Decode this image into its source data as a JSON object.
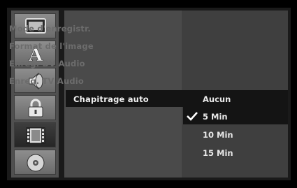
{
  "sidebar": {
    "tabs": [
      {
        "icon": "display-icon",
        "selected": false
      },
      {
        "icon": "language-icon",
        "glyph": "A",
        "selected": false
      },
      {
        "icon": "speaker-icon",
        "selected": false
      },
      {
        "icon": "lock-icon",
        "selected": false
      },
      {
        "icon": "film-icon",
        "selected": true
      },
      {
        "icon": "disc-icon",
        "selected": false
      }
    ]
  },
  "menu": {
    "items": [
      "Mode d'enregistr.",
      "Format de l'image",
      "Enreg. DV Audio",
      "Enreg. TV Audio",
      "Chapitrage auto"
    ],
    "active_index": 4
  },
  "options": {
    "items": [
      "Aucun",
      "5 Min",
      "10 Min",
      "15 Min"
    ],
    "selected": "5 Min"
  },
  "colors": {
    "background": "#000000",
    "panel_left": "#4a4a4a",
    "panel_right": "#3f3f3f",
    "highlight": "#141414",
    "text_active": "#f0f0f0",
    "text_disabled": "#6c6c6c"
  }
}
